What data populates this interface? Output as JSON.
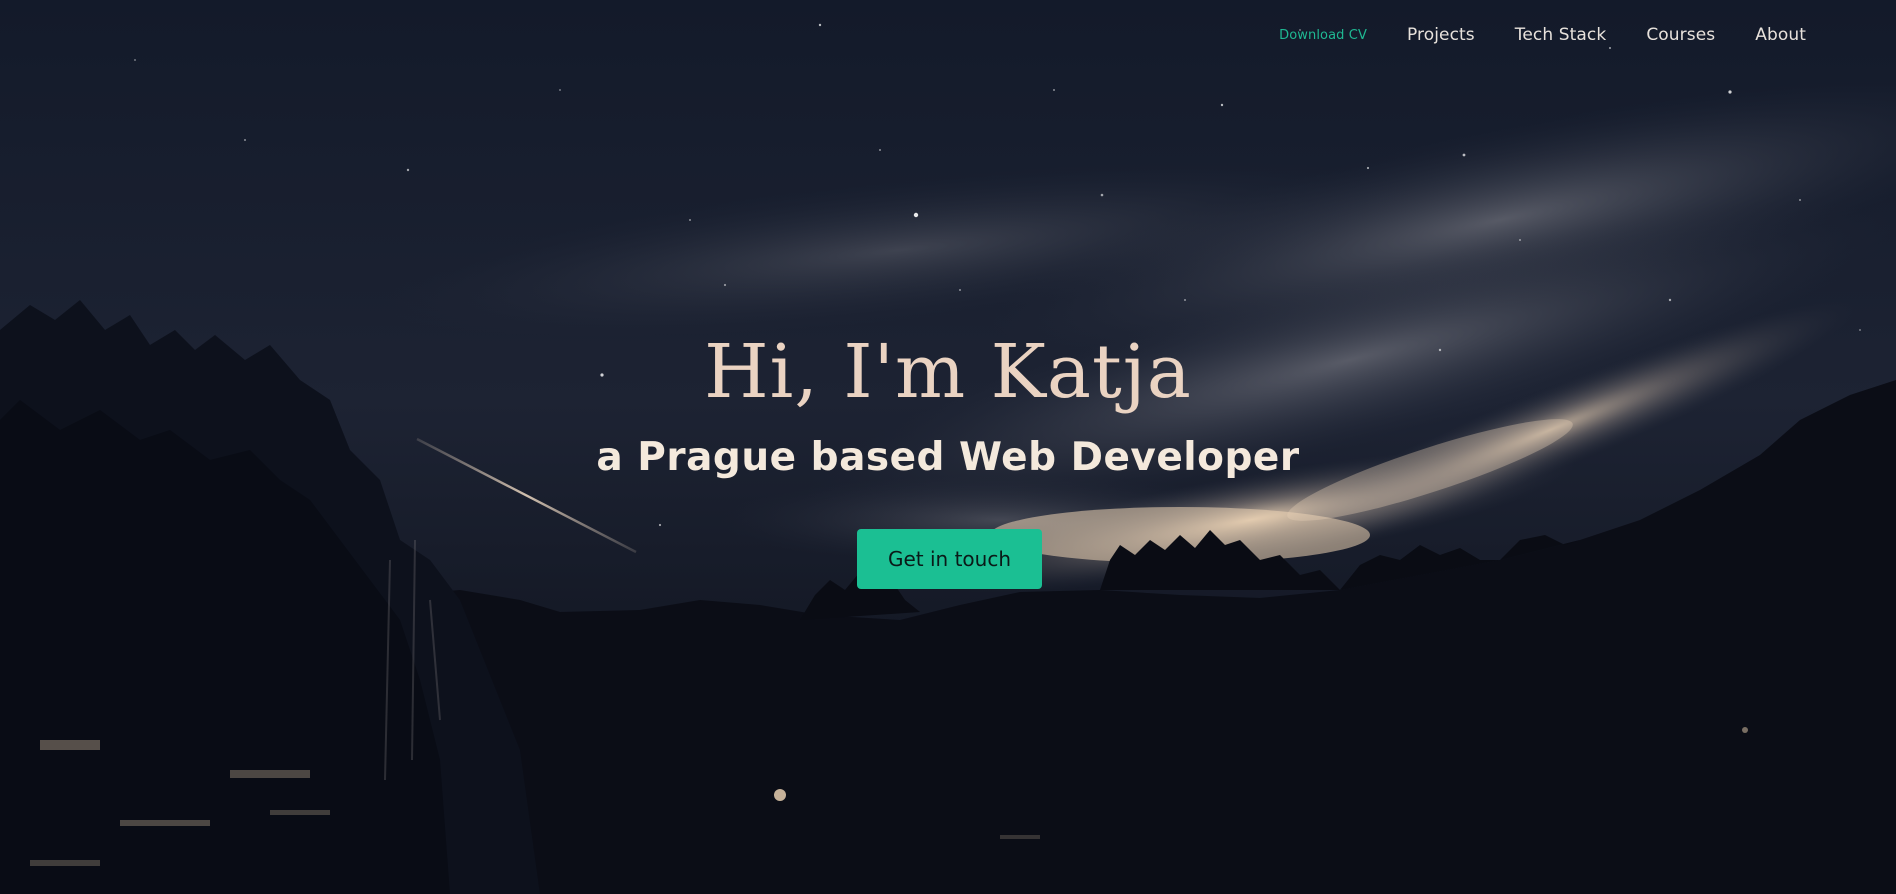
{
  "nav": {
    "download_cv": "Download CV",
    "projects": "Projects",
    "tech_stack": "Tech Stack",
    "courses": "Courses",
    "about": "About"
  },
  "hero": {
    "title": "Hi, I'm Katja",
    "subtitle": "a Prague based Web Developer",
    "cta_label": "Get in touch"
  },
  "colors": {
    "accent": "#1bbf93",
    "nav_cv": "#1fb892",
    "title": "#ead3c2",
    "subtitle": "#f4e9dc",
    "sky_dark": "#0b101c",
    "glow": "#d9c0a5"
  }
}
